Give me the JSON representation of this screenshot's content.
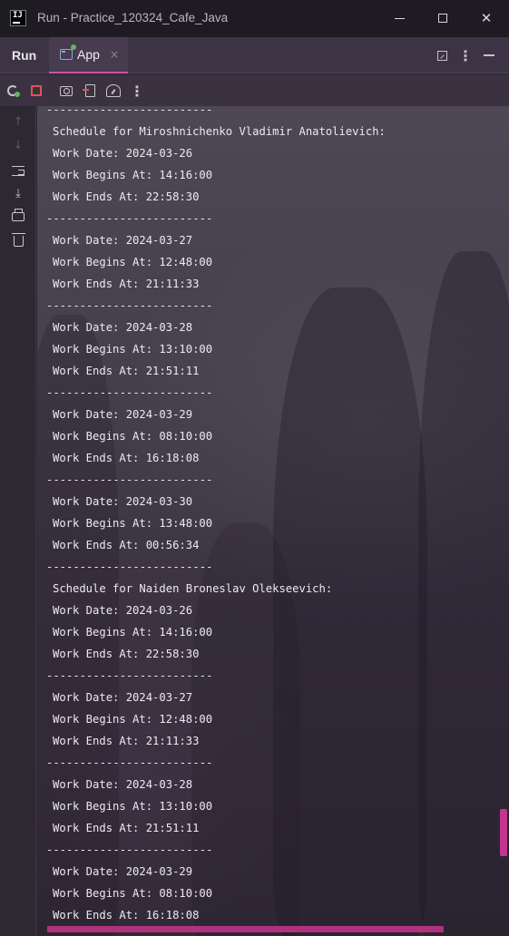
{
  "window": {
    "title": "Run - Practice_120324_Cafe_Java",
    "logo_text": "IJ"
  },
  "tabbar": {
    "run_label": "Run",
    "tab_label": "App",
    "tab_close": "×"
  },
  "icons": {
    "titlebar": [
      "intellij-logo-icon",
      "minimize-icon",
      "maximize-icon",
      "close-icon"
    ],
    "tabbar": [
      "application-icon",
      "tab-close-icon",
      "restore-layout-icon",
      "more-options-icon",
      "hide-panel-icon"
    ],
    "toolbar": [
      "rerun-icon",
      "stop-icon",
      "camera-icon",
      "exit-icon",
      "profiler-gauge-icon",
      "more-options-icon"
    ],
    "gutter": [
      "arrow-up-icon",
      "arrow-down-icon",
      "soft-wrap-icon",
      "scroll-to-end-icon",
      "print-icon",
      "trash-icon"
    ]
  },
  "colors": {
    "accent": "#d24fa8",
    "stop": "#e05555",
    "running": "#5fb85f"
  },
  "console": {
    "lines": [
      {
        "kind": "sep",
        "text": "-------------------------"
      },
      {
        "kind": "txt",
        "text": "Schedule for Miroshnichenko Vladimir Anatolievich:"
      },
      {
        "kind": "txt",
        "text": "Work Date: 2024-03-26"
      },
      {
        "kind": "txt",
        "text": "Work Begins At: 14:16:00"
      },
      {
        "kind": "txt",
        "text": "Work Ends At: 22:58:30"
      },
      {
        "kind": "sep",
        "text": "-------------------------"
      },
      {
        "kind": "txt",
        "text": "Work Date: 2024-03-27"
      },
      {
        "kind": "txt",
        "text": "Work Begins At: 12:48:00"
      },
      {
        "kind": "txt",
        "text": "Work Ends At: 21:11:33"
      },
      {
        "kind": "sep",
        "text": "-------------------------"
      },
      {
        "kind": "txt",
        "text": "Work Date: 2024-03-28"
      },
      {
        "kind": "txt",
        "text": "Work Begins At: 13:10:00"
      },
      {
        "kind": "txt",
        "text": "Work Ends At: 21:51:11"
      },
      {
        "kind": "sep",
        "text": "-------------------------"
      },
      {
        "kind": "txt",
        "text": "Work Date: 2024-03-29"
      },
      {
        "kind": "txt",
        "text": "Work Begins At: 08:10:00"
      },
      {
        "kind": "txt",
        "text": "Work Ends At: 16:18:08"
      },
      {
        "kind": "sep",
        "text": "-------------------------"
      },
      {
        "kind": "txt",
        "text": "Work Date: 2024-03-30"
      },
      {
        "kind": "txt",
        "text": "Work Begins At: 13:48:00"
      },
      {
        "kind": "txt",
        "text": "Work Ends At: 00:56:34"
      },
      {
        "kind": "sep",
        "text": "-------------------------"
      },
      {
        "kind": "txt",
        "text": "Schedule for Naiden Broneslav Olekseevich:"
      },
      {
        "kind": "txt",
        "text": "Work Date: 2024-03-26"
      },
      {
        "kind": "txt",
        "text": "Work Begins At: 14:16:00"
      },
      {
        "kind": "txt",
        "text": "Work Ends At: 22:58:30"
      },
      {
        "kind": "sep",
        "text": "-------------------------"
      },
      {
        "kind": "txt",
        "text": "Work Date: 2024-03-27"
      },
      {
        "kind": "txt",
        "text": "Work Begins At: 12:48:00"
      },
      {
        "kind": "txt",
        "text": "Work Ends At: 21:11:33"
      },
      {
        "kind": "sep",
        "text": "-------------------------"
      },
      {
        "kind": "txt",
        "text": "Work Date: 2024-03-28"
      },
      {
        "kind": "txt",
        "text": "Work Begins At: 13:10:00"
      },
      {
        "kind": "txt",
        "text": "Work Ends At: 21:51:11"
      },
      {
        "kind": "sep",
        "text": "-------------------------"
      },
      {
        "kind": "txt",
        "text": "Work Date: 2024-03-29"
      },
      {
        "kind": "txt",
        "text": "Work Begins At: 08:10:00"
      },
      {
        "kind": "txt",
        "text": "Work Ends At: 16:18:08"
      }
    ]
  }
}
